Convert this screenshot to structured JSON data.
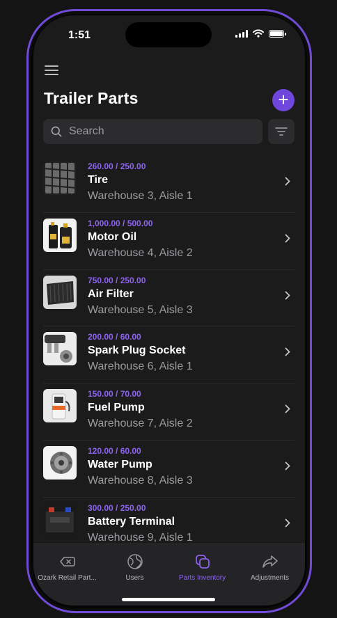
{
  "status_bar": {
    "time": "1:51"
  },
  "header": {
    "title": "Trailer Parts"
  },
  "search": {
    "placeholder": "Search"
  },
  "items": [
    {
      "qty": "260.00 / 250.00",
      "name": "Tire",
      "location": "Warehouse 3, Aisle 1"
    },
    {
      "qty": "1,000.00 / 500.00",
      "name": "Motor Oil",
      "location": "Warehouse 4, Aisle 2"
    },
    {
      "qty": "750.00 / 250.00",
      "name": "Air Filter",
      "location": "Warehouse 5, Aisle 3"
    },
    {
      "qty": "200.00 / 60.00",
      "name": "Spark Plug Socket",
      "location": "Warehouse 6, Aisle 1"
    },
    {
      "qty": "150.00 / 70.00",
      "name": "Fuel Pump",
      "location": "Warehouse 7, Aisle 2"
    },
    {
      "qty": "120.00 / 60.00",
      "name": "Water Pump",
      "location": "Warehouse 8, Aisle 3"
    },
    {
      "qty": "300.00 / 250.00",
      "name": "Battery Terminal",
      "location": "Warehouse 9, Aisle 1"
    }
  ],
  "tabs": [
    {
      "label": "Ozark Retail Part...",
      "icon": "backspace-icon"
    },
    {
      "label": "Users",
      "icon": "globe-icon"
    },
    {
      "label": "Parts Inventory",
      "icon": "inventory-icon",
      "active": true
    },
    {
      "label": "Adjustments",
      "icon": "share-arrow-icon"
    }
  ],
  "colors": {
    "accent": "#6f47dd",
    "frame": "#6f4bd6",
    "background": "#1b1b1c"
  }
}
